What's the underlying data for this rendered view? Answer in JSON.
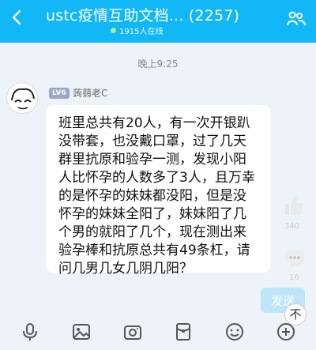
{
  "header": {
    "title": "ustc疫情互助文档...  (2257)",
    "online": "1915人在线"
  },
  "chat": {
    "time": "晚上9:25",
    "message": {
      "level": "LV6",
      "nickname": "蒟蒻老C",
      "lines": [
        "班里总共有20人，有一次开银趴",
        "没带套，也没戴口罩，过了几天",
        "群里抗原和验孕一测，发现小阳",
        "人比怀孕的人数多了3人，且万幸",
        "的是怀孕的妹妹都没阳，但是没",
        "怀孕的妹妹全阳了，妹妹阳了几",
        "个男的就阳了几个，现在测出来",
        "验孕棒和抗原总共有49条杠，请",
        "问几男几女几阴几阳？"
      ]
    },
    "likes": "340",
    "comments": "16"
  },
  "input": {
    "send_label": "发送",
    "fab_label": "不"
  },
  "colors": {
    "header": "#12b7f5",
    "background": "#eef3f9",
    "send": "#bfe5fb"
  }
}
